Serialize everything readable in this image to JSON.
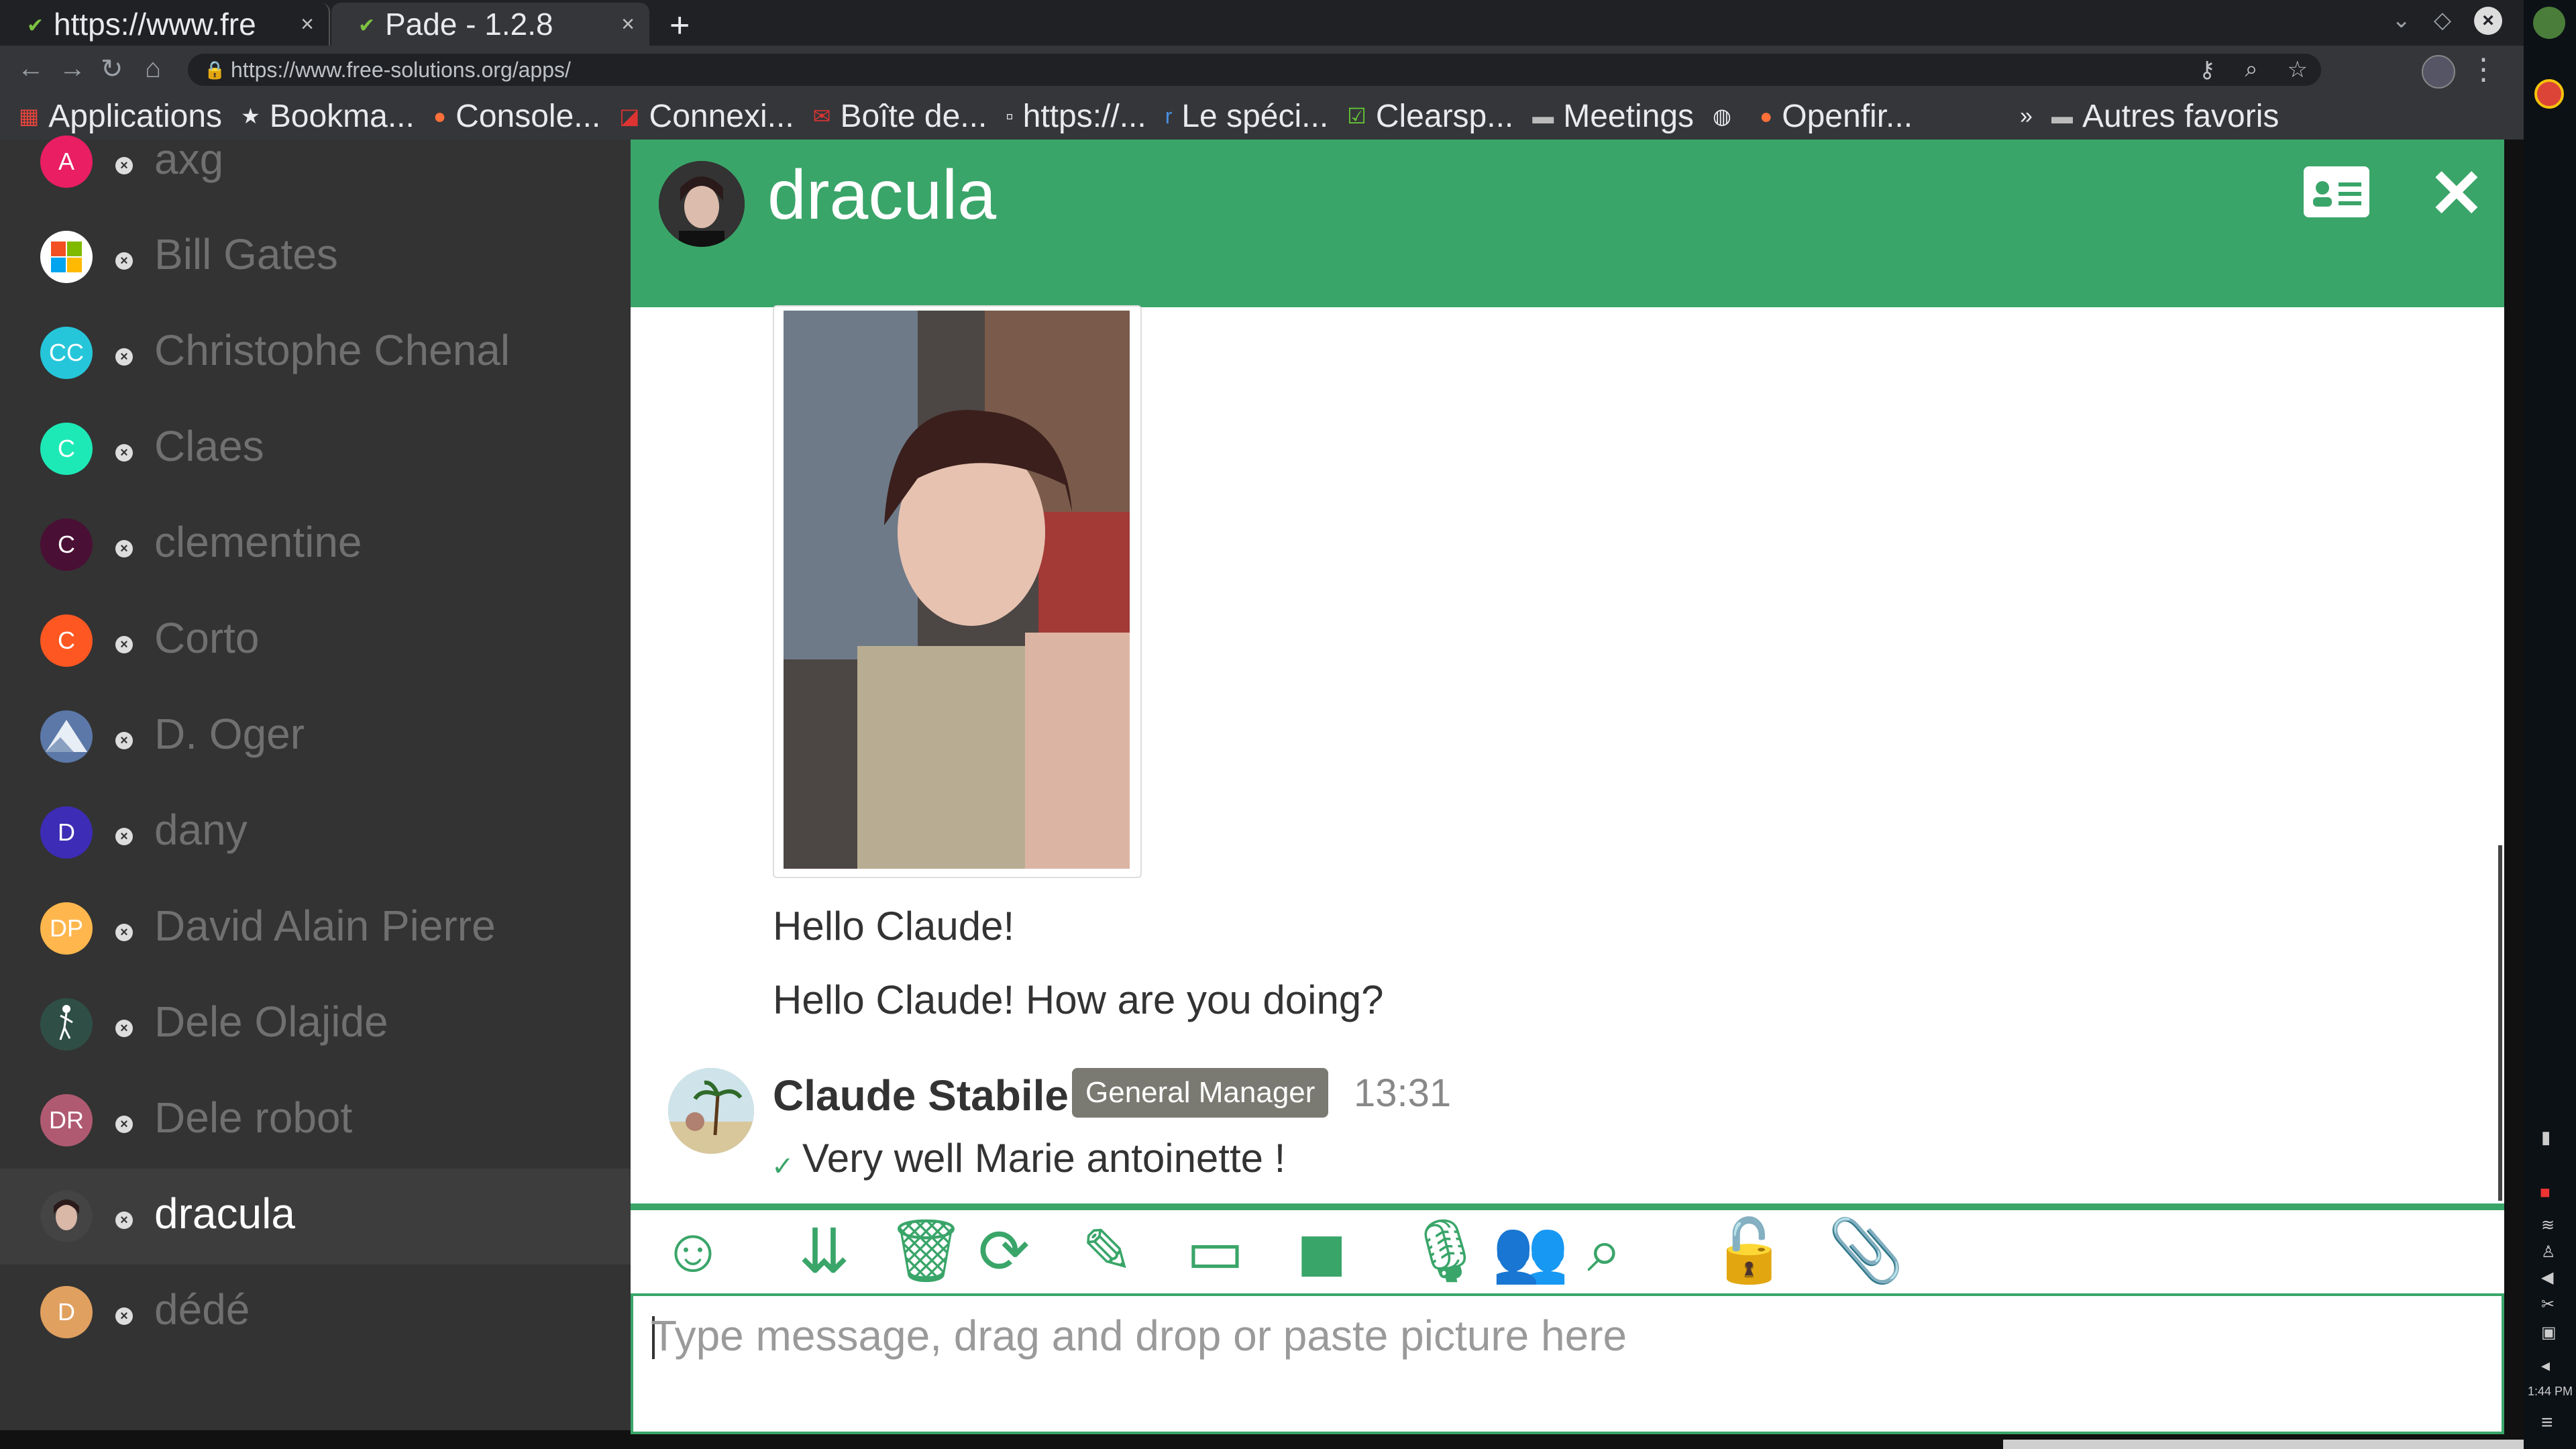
{
  "browser": {
    "tabs": [
      {
        "title": "https://www.fre",
        "active": false
      },
      {
        "title": "Pade - 1.2.8",
        "active": true
      }
    ],
    "new_tab_symbol": "+",
    "url": "https://www.free-solutions.org/apps/",
    "bookmarks": [
      {
        "label": "Applications",
        "icon": "apps-grid-icon"
      },
      {
        "label": "Bookma...",
        "icon": "star-icon"
      },
      {
        "label": "Console...",
        "icon": "firefox-icon"
      },
      {
        "label": "Connexi...",
        "icon": "connexion-icon"
      },
      {
        "label": "Boîte de...",
        "icon": "mail-icon"
      },
      {
        "label": "https://...",
        "icon": "page-icon"
      },
      {
        "label": "Le spéci...",
        "icon": "r-icon"
      },
      {
        "label": "Clearsp...",
        "icon": "clearspace-icon"
      },
      {
        "label": "Meetings",
        "icon": "folder-icon"
      },
      {
        "label": "",
        "icon": "globe-icon"
      },
      {
        "label": "Openfir...",
        "icon": "openfire-icon"
      }
    ],
    "overflow_symbol": "»",
    "other_bookmarks": "Autres favoris"
  },
  "roster": {
    "contacts": [
      {
        "name": "axg",
        "initials": "A",
        "color": "#e91e63",
        "active": false
      },
      {
        "name": "Bill Gates",
        "initials": "",
        "color": "#ffffff",
        "active": false
      },
      {
        "name": "Christophe Chenal",
        "initials": "CC",
        "color": "#26c6da",
        "active": false
      },
      {
        "name": "Claes",
        "initials": "C",
        "color": "#1de9b6",
        "active": false
      },
      {
        "name": "clementine",
        "initials": "C",
        "color": "#4a0f34",
        "active": false
      },
      {
        "name": "Corto",
        "initials": "C",
        "color": "#ff5722",
        "active": false
      },
      {
        "name": "D. Oger",
        "initials": "",
        "color": "#5b78a8",
        "active": false
      },
      {
        "name": "dany",
        "initials": "D",
        "color": "#3d2cb5",
        "active": false
      },
      {
        "name": "David Alain Pierre",
        "initials": "DP",
        "color": "#ffb74d",
        "active": false
      },
      {
        "name": "Dele Olajide",
        "initials": "",
        "color": "#2f4f46",
        "active": false
      },
      {
        "name": "Dele robot",
        "initials": "DR",
        "color": "#b05a72",
        "active": false
      },
      {
        "name": "dracula",
        "initials": "",
        "color": "#222222",
        "active": true
      },
      {
        "name": "dédé",
        "initials": "D",
        "color": "#e0a060",
        "active": false
      }
    ]
  },
  "chat": {
    "title": "dracula",
    "messages": [
      {
        "text": "Hello Claude!"
      },
      {
        "text": "Hello Claude! How are you doing?"
      }
    ],
    "reply": {
      "sender": "Claude Stabile",
      "role": "General Manager",
      "time": "13:31",
      "text": "Very well Marie antoinette !"
    },
    "input_placeholder": "Type message, drag and drop or paste picture here",
    "toolbar_icons": [
      "emoji-icon",
      "scroll-down-icon",
      "trash-icon",
      "refresh-icon",
      "pencil-icon",
      "screen-share-icon",
      "video-call-icon",
      "microphone-icon",
      "people-icon",
      "search-icon",
      "unlock-icon",
      "paperclip-icon"
    ]
  },
  "os": {
    "clock": "1:44 PM"
  },
  "colors": {
    "accent": "#3aa569",
    "roster_bg": "#333333"
  }
}
